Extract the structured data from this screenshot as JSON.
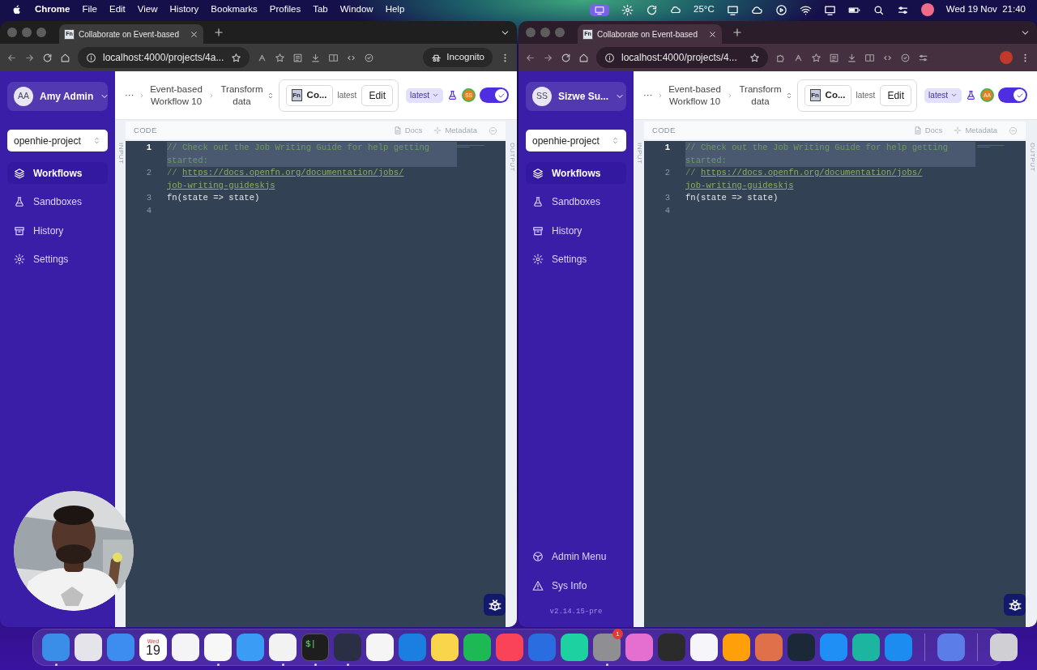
{
  "menu_bar": {
    "app": "Chrome",
    "menus": [
      "File",
      "Edit",
      "View",
      "History",
      "Bookmarks",
      "Profiles",
      "Tab",
      "Window",
      "Help"
    ],
    "weather": "25°C",
    "clock": "Wed 19 Nov  21:40"
  },
  "windows": [
    {
      "tab": {
        "favicon": "Fn",
        "title": "Collaborate on Event-based"
      },
      "url": "localhost:4000/projects/4a...",
      "profile": {
        "kind": "incognito",
        "label": "Incognito"
      },
      "sidebar": {
        "initials": "AA",
        "user": "Amy Admin",
        "project": "openhie-project",
        "items": [
          {
            "label": "Workflows",
            "kind": "workflows",
            "selected": true
          },
          {
            "label": "Sandboxes",
            "kind": "sandboxes",
            "selected": false
          },
          {
            "label": "History",
            "kind": "history",
            "selected": false
          },
          {
            "label": "Settings",
            "kind": "settings",
            "selected": false
          }
        ]
      },
      "header": {
        "overflow": "···",
        "breadcrumbs": [
          "Event-based Workflow 10",
          "Transform data"
        ],
        "adaptor_logo": "Fn",
        "adaptor": "Co...",
        "adaptor_version": "latest",
        "edit": "Edit",
        "version_badge": "latest",
        "collaborator": "SS",
        "toggle": {
          "on": true
        }
      },
      "code": {
        "title": "CODE",
        "docs": "Docs",
        "metadata": "Metadata",
        "input_label": "INPUT",
        "output_label": "OUTPUT",
        "lines": [
          {
            "number": "1",
            "kind": "comment",
            "text": "// Check out the Job Writing Guide for help getting started:",
            "highlighted": true
          },
          {
            "number": "2",
            "kind": "link",
            "prefix": "// ",
            "text": "https://docs.openfn.org/documentation/jobs/job-writing-guideskjs",
            "highlighted": false
          },
          {
            "number": "3",
            "kind": "code",
            "text": "fn(state => state)",
            "highlighted": false
          },
          {
            "number": "4",
            "kind": "code",
            "highlighted": false
          }
        ]
      }
    },
    {
      "tab": {
        "favicon": "Fn",
        "title": "Collaborate on Event-based"
      },
      "url": "localhost:4000/projects/4...",
      "profile": {
        "kind": "avatar"
      },
      "sidebar": {
        "initials": "SS",
        "user": "Sizwe Su...",
        "project": "openhie-project",
        "items": [
          {
            "label": "Workflows",
            "kind": "workflows",
            "selected": true
          },
          {
            "label": "Sandboxes",
            "kind": "sandboxes",
            "selected": false
          },
          {
            "label": "History",
            "kind": "history",
            "selected": false
          },
          {
            "label": "Settings",
            "kind": "settings",
            "selected": false
          }
        ],
        "footer_items": [
          {
            "label": "Admin Menu",
            "kind": "admin"
          },
          {
            "label": "Sys Info",
            "kind": "sysinfo"
          }
        ],
        "version": "v2.14.15-pre"
      },
      "header": {
        "overflow": "···",
        "breadcrumbs": [
          "Event-based Workflow 10",
          "Transform data"
        ],
        "adaptor_logo": "Fn",
        "adaptor": "Co...",
        "adaptor_version": "latest",
        "edit": "Edit",
        "version_badge": "latest",
        "collaborator": "AA",
        "toggle": {
          "on": true
        }
      },
      "code": {
        "title": "CODE",
        "docs": "Docs",
        "metadata": "Metadata",
        "input_label": "INPUT",
        "output_label": "OUTPUT",
        "lines": [
          {
            "number": "1",
            "kind": "comment",
            "text": "// Check out the Job Writing Guide for help getting started:",
            "highlighted": true
          },
          {
            "number": "2",
            "kind": "link",
            "prefix": "// ",
            "text": "https://docs.openfn.org/documentation/jobs/job-writing-guideskjs",
            "highlighted": false
          },
          {
            "number": "3",
            "kind": "code",
            "text": "fn(state => state)",
            "highlighted": false
          },
          {
            "number": "4",
            "kind": "code",
            "highlighted": false
          }
        ]
      }
    }
  ],
  "dock": [
    {
      "kind": "app",
      "color": "#3b8ee8",
      "running": true
    },
    {
      "kind": "app",
      "color": "#e4e4ea",
      "running": false
    },
    {
      "kind": "app",
      "color": "#3d8cf0",
      "running": false
    },
    {
      "kind": "calendar",
      "day": "Wed",
      "date": "19",
      "running": false
    },
    {
      "kind": "app",
      "color": "#f4f4f6",
      "running": false
    },
    {
      "kind": "app",
      "color": "#f7f7f7",
      "running": true
    },
    {
      "kind": "app",
      "color": "#3a9cf5",
      "running": false
    },
    {
      "kind": "app",
      "color": "#f2f2f2",
      "running": true
    },
    {
      "kind": "terminal",
      "text": "$|",
      "running": true
    },
    {
      "kind": "app",
      "color": "#2a2f45",
      "running": true
    },
    {
      "kind": "app",
      "color": "#f5f5f5",
      "running": false
    },
    {
      "kind": "app",
      "color": "#1a7fe0",
      "running": false
    },
    {
      "kind": "app",
      "color": "#f8d54a",
      "running": false
    },
    {
      "kind": "app",
      "color": "#1db954",
      "running": false
    },
    {
      "kind": "app",
      "color": "#fa4259",
      "running": false
    },
    {
      "kind": "app",
      "color": "#2a6de0",
      "running": false
    },
    {
      "kind": "app",
      "color": "#1dd1a1",
      "running": false
    },
    {
      "kind": "app",
      "color": "#8e8e93",
      "running": true,
      "badge": "1"
    },
    {
      "kind": "app",
      "color": "#e56fd0",
      "running": false
    },
    {
      "kind": "app",
      "color": "#2b2b2b",
      "running": false
    },
    {
      "kind": "app",
      "color": "#f6f6fa",
      "running": false
    },
    {
      "kind": "app",
      "color": "#ff9f0a",
      "running": false
    },
    {
      "kind": "app",
      "color": "#e0704a",
      "running": false
    },
    {
      "kind": "app",
      "color": "#1b2838",
      "running": false
    },
    {
      "kind": "app",
      "color": "#1f8ef5",
      "running": false
    },
    {
      "kind": "app",
      "color": "#1bb5a0",
      "running": false
    },
    {
      "kind": "app",
      "color": "#1d8cf0",
      "running": false
    },
    {
      "kind": "separator"
    },
    {
      "kind": "app",
      "color": "#5a7de8",
      "running": false
    },
    {
      "kind": "separator"
    },
    {
      "kind": "app",
      "color": "#d0d0d4",
      "running": false
    }
  ]
}
